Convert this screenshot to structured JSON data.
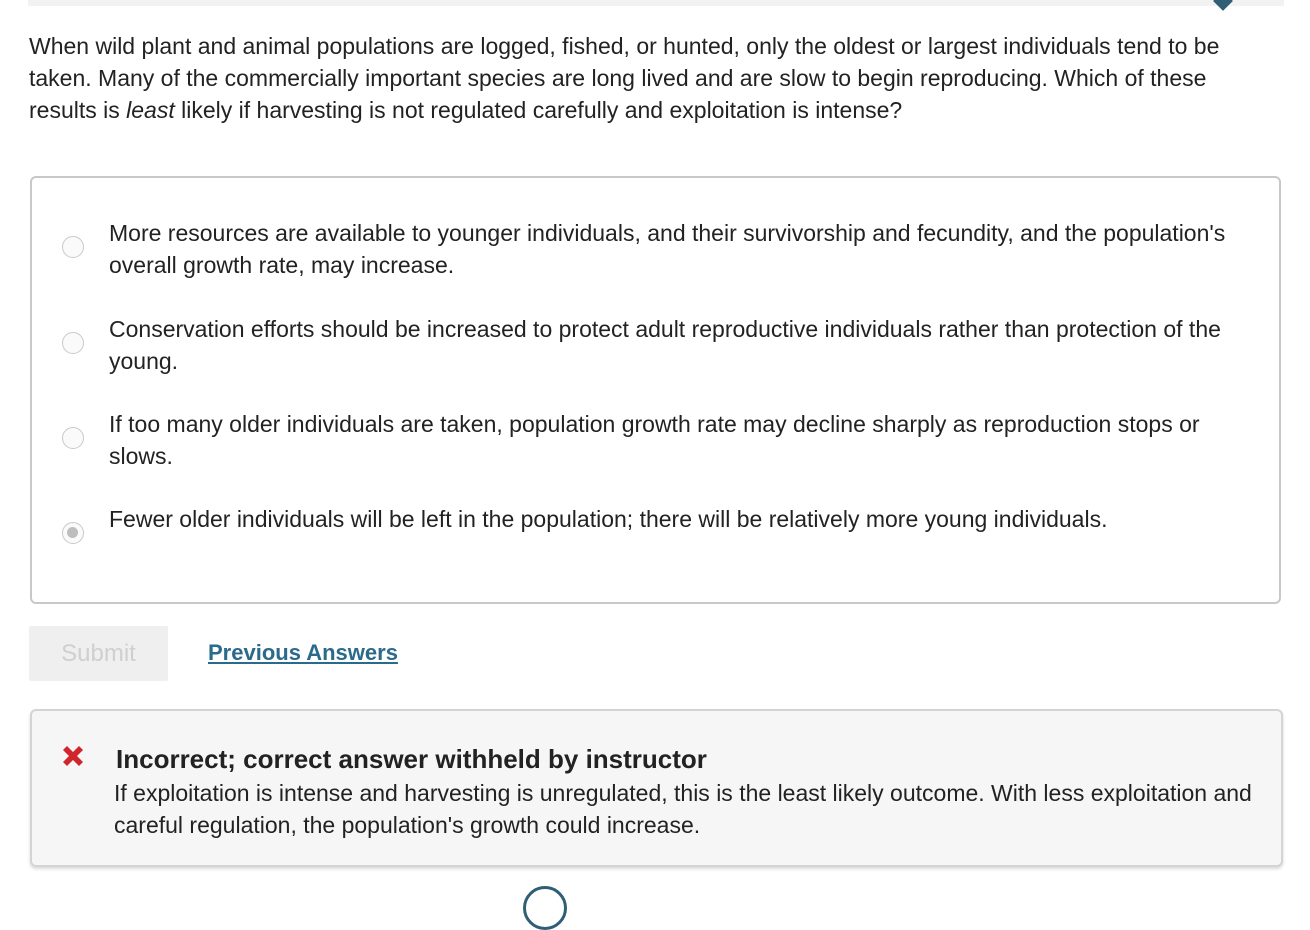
{
  "question": {
    "text_before": "When wild plant and animal populations are logged, fished, or hunted, only the oldest or largest individuals tend to be taken. Many of the commercially important species are long lived and are slow to begin reproducing. Which of these results is ",
    "emphasis": "least",
    "text_after": " likely if harvesting is not regulated carefully and exploitation is intense?"
  },
  "options": [
    {
      "text": "More resources are available to younger individuals, and their survivorship and fecundity, and the population's overall growth rate, may increase.",
      "selected": false
    },
    {
      "text": "Conservation efforts should be increased to protect adult reproductive individuals rather than protection of the young.",
      "selected": false
    },
    {
      "text": "If too many older individuals are taken, population growth rate may decline sharply as reproduction stops or slows.",
      "selected": false
    },
    {
      "text": "Fewer older individuals will be left in the population; there will be relatively more young individuals.",
      "selected": true
    }
  ],
  "actions": {
    "submit_label": "Submit",
    "previous_answers_label": "Previous Answers"
  },
  "feedback": {
    "status": "incorrect",
    "icon": "x-mark-icon",
    "title": "Incorrect; correct answer withheld by instructor",
    "text": "If exploitation is intense and harvesting is unregulated, this is the least likely outcome. With less exploitation and careful regulation, the population's growth could increase."
  },
  "colors": {
    "link": "#2a6a8a",
    "error_icon": "#d0262b",
    "accent": "#2f5e75"
  }
}
